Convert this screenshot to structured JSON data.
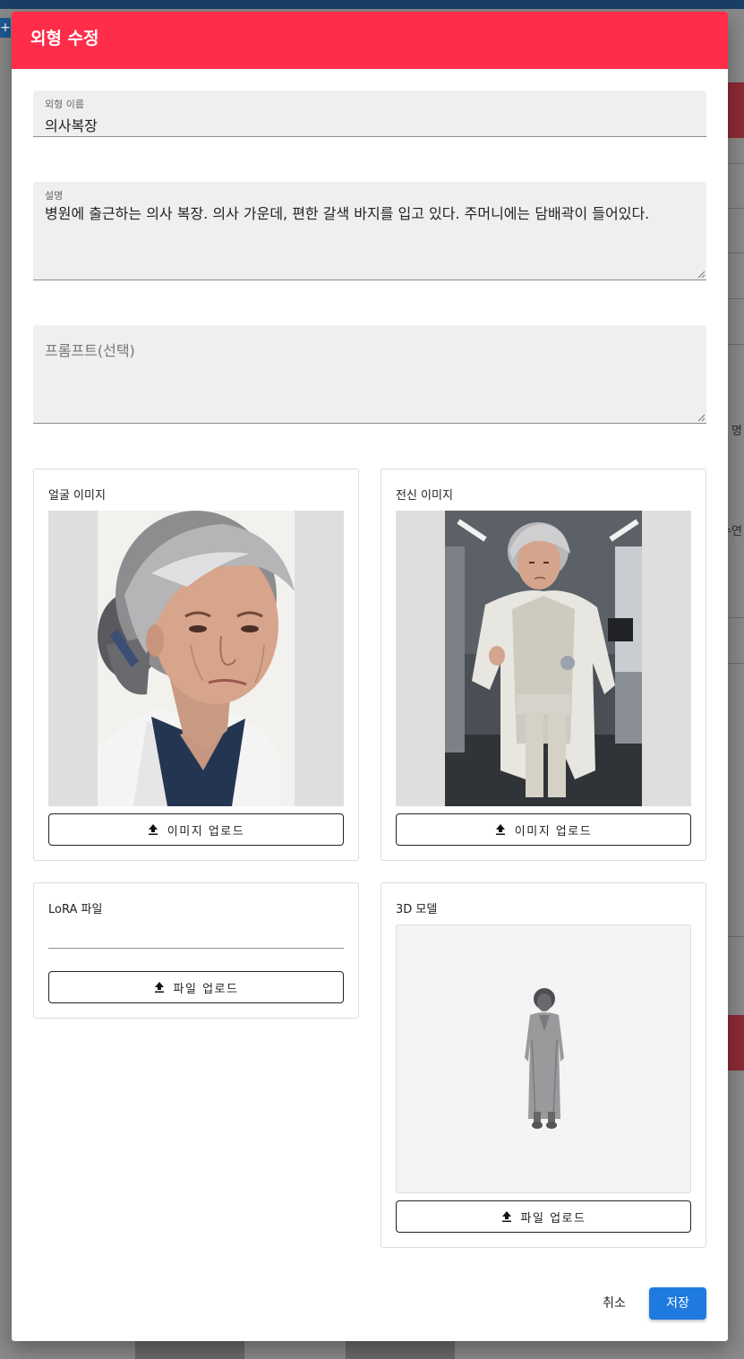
{
  "background": {
    "plus_label": "+",
    "fragment_1": "명",
    "fragment_2": "수연"
  },
  "dialog": {
    "title": "외형 수정",
    "name_field": {
      "label": "외형 이름",
      "value": "의사복장"
    },
    "description_field": {
      "label": "설명",
      "value": "병원에 출근하는 의사 복장. 의사 가운데, 편한 갈색 바지를 입고 있다. 주머니에는 담배곽이 들어있다."
    },
    "prompt_field": {
      "placeholder": "프롬프트(선택)"
    },
    "face_image": {
      "title": "얼굴 이미지",
      "upload_label": "이미지 업로드"
    },
    "body_image": {
      "title": "전신 이미지",
      "upload_label": "이미지 업로드"
    },
    "lora": {
      "title": "LoRA 파일",
      "upload_label": "파일 업로드"
    },
    "model3d": {
      "title": "3D 모델",
      "upload_label": "파일 업로드"
    },
    "actions": {
      "cancel": "취소",
      "save": "저장"
    },
    "colors": {
      "header": "#ff2d4a",
      "primary": "#1f7ae0"
    }
  }
}
